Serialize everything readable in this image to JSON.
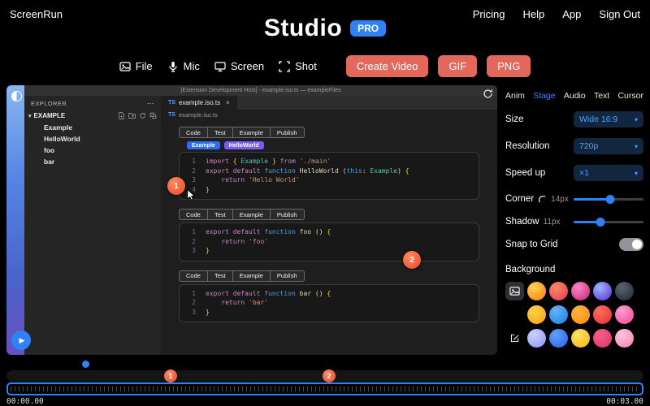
{
  "header": {
    "brand": "ScreenRun",
    "title": "Studio",
    "badge": "PRO",
    "links": [
      "Pricing",
      "Help",
      "App",
      "Sign Out"
    ]
  },
  "toolbar": {
    "sources": [
      {
        "icon": "file-image-icon",
        "label": "File"
      },
      {
        "icon": "mic-icon",
        "label": "Mic"
      },
      {
        "icon": "screen-icon",
        "label": "Screen"
      },
      {
        "icon": "shot-icon",
        "label": "Shot"
      }
    ],
    "actions": [
      {
        "label": "Create Video"
      },
      {
        "label": "GIF"
      },
      {
        "label": "PNG"
      }
    ]
  },
  "preview": {
    "window_title": "[Extension Development Host] - example.iso.ts — exampleFiles",
    "explorer": {
      "title": "EXPLORER",
      "more": "⋯",
      "section": "EXAMPLE",
      "files": [
        "Example",
        "HelloWorld",
        "foo",
        "bar"
      ]
    },
    "tab": {
      "lang": "TS",
      "name": "example.iso.ts",
      "close": "×"
    },
    "breadcrumb": {
      "lang": "TS",
      "name": "example.iso.ts"
    },
    "blocks": [
      {
        "tabs": [
          "Code",
          "Test",
          "Example",
          "Publish"
        ],
        "badges": [
          {
            "label": "Example",
            "color": "#2f6bf0"
          },
          {
            "label": "HelloWorld",
            "color": "#7a5cf0"
          }
        ],
        "lines": [
          {
            "num": "1",
            "tokens": [
              {
                "t": "import",
                "c": "kw"
              },
              {
                "t": " ",
                "c": "pl"
              },
              {
                "t": "{",
                "c": "br"
              },
              {
                "t": " ",
                "c": "pl"
              },
              {
                "t": "Example",
                "c": "ty"
              },
              {
                "t": " ",
                "c": "pl"
              },
              {
                "t": "}",
                "c": "br"
              },
              {
                "t": " ",
                "c": "pl"
              },
              {
                "t": "from",
                "c": "kw"
              },
              {
                "t": " ",
                "c": "pl"
              },
              {
                "t": "'./main'",
                "c": "st"
              }
            ]
          },
          {
            "num": "2",
            "tokens": [
              {
                "t": "export",
                "c": "kw"
              },
              {
                "t": " ",
                "c": "pl"
              },
              {
                "t": "default",
                "c": "kw"
              },
              {
                "t": " ",
                "c": "pl"
              },
              {
                "t": "function",
                "c": "fn2"
              },
              {
                "t": " ",
                "c": "pl"
              },
              {
                "t": "HelloWorld",
                "c": "fn"
              },
              {
                "t": " (",
                "c": "pl"
              },
              {
                "t": "this",
                "c": "th"
              },
              {
                "t": ": ",
                "c": "pl"
              },
              {
                "t": "Example",
                "c": "ty"
              },
              {
                "t": ") ",
                "c": "pl"
              },
              {
                "t": "{",
                "c": "br"
              }
            ]
          },
          {
            "num": "3",
            "tokens": [
              {
                "t": "    ",
                "c": "pl"
              },
              {
                "t": "return",
                "c": "kw"
              },
              {
                "t": " ",
                "c": "pl"
              },
              {
                "t": "'Hello World'",
                "c": "st"
              }
            ]
          },
          {
            "num": "4",
            "tokens": [
              {
                "t": "}",
                "c": "br"
              }
            ]
          }
        ]
      },
      {
        "tabs": [
          "Code",
          "Test",
          "Example",
          "Publish"
        ],
        "badges": [],
        "lines": [
          {
            "num": "1",
            "tokens": [
              {
                "t": "export",
                "c": "kw"
              },
              {
                "t": " ",
                "c": "pl"
              },
              {
                "t": "default",
                "c": "kw"
              },
              {
                "t": " ",
                "c": "pl"
              },
              {
                "t": "function",
                "c": "fn2"
              },
              {
                "t": " ",
                "c": "pl"
              },
              {
                "t": "foo",
                "c": "fn"
              },
              {
                "t": " () ",
                "c": "pl"
              },
              {
                "t": "{",
                "c": "br"
              }
            ]
          },
          {
            "num": "2",
            "tokens": [
              {
                "t": "    ",
                "c": "pl"
              },
              {
                "t": "return",
                "c": "kw"
              },
              {
                "t": " ",
                "c": "pl"
              },
              {
                "t": "'foo'",
                "c": "st"
              }
            ]
          },
          {
            "num": "3",
            "tokens": [
              {
                "t": "}",
                "c": "br"
              }
            ]
          }
        ]
      },
      {
        "tabs": [
          "Code",
          "Test",
          "Example",
          "Publish"
        ],
        "badges": [],
        "lines": [
          {
            "num": "1",
            "tokens": [
              {
                "t": "export",
                "c": "kw"
              },
              {
                "t": " ",
                "c": "pl"
              },
              {
                "t": "default",
                "c": "kw"
              },
              {
                "t": " ",
                "c": "pl"
              },
              {
                "t": "function",
                "c": "fn2"
              },
              {
                "t": " ",
                "c": "pl"
              },
              {
                "t": "bar",
                "c": "fn"
              },
              {
                "t": " () ",
                "c": "pl"
              },
              {
                "t": "{",
                "c": "br"
              }
            ]
          },
          {
            "num": "2",
            "tokens": [
              {
                "t": "    ",
                "c": "pl"
              },
              {
                "t": "return",
                "c": "kw"
              },
              {
                "t": " ",
                "c": "pl"
              },
              {
                "t": "'bar'",
                "c": "st"
              }
            ]
          },
          {
            "num": "3",
            "tokens": [
              {
                "t": "}",
                "c": "br"
              }
            ]
          }
        ]
      }
    ],
    "markers": [
      {
        "n": "1"
      },
      {
        "n": "2"
      }
    ]
  },
  "panel": {
    "tabs": [
      {
        "label": "Anim",
        "active": false
      },
      {
        "label": "Stage",
        "active": true
      },
      {
        "label": "Audio",
        "active": false
      },
      {
        "label": "Text",
        "active": false
      },
      {
        "label": "Cursor",
        "active": false
      }
    ],
    "size": {
      "label": "Size",
      "value": "Wide 16:9"
    },
    "resolution": {
      "label": "Resolution",
      "value": "720p"
    },
    "speed": {
      "label": "Speed up",
      "value": "×1"
    },
    "corner": {
      "label": "Corner",
      "value": "14px",
      "percent": 52
    },
    "shadow": {
      "label": "Shadow",
      "value": "11px",
      "percent": 38
    },
    "snap": {
      "label": "Snap to Grid",
      "on": false
    },
    "background": {
      "label": "Background",
      "rows": [
        {
          "swatches": [
            [
              "#ffd34d",
              "#ff7a1a"
            ],
            [
              "#ff8a5c",
              "#e2395f"
            ],
            [
              "#ff86c2",
              "#c02678"
            ],
            [
              "#9db4ff",
              "#5b2bd6"
            ],
            [
              "#5a6472",
              "#23262e"
            ]
          ]
        },
        {
          "swatches": [
            [
              "#ffd24a",
              "#f59f0a"
            ],
            [
              "#63b3ff",
              "#1e80d9"
            ],
            [
              "#ffb347",
              "#ff8c00"
            ],
            [
              "#ff6b5e",
              "#e03131"
            ],
            [
              "#ff9bd0",
              "#ec4899"
            ]
          ]
        },
        {
          "swatches": [
            [
              "#cdd2ff",
              "#8b93f8"
            ],
            [
              "#5ea0ff",
              "#2563eb"
            ],
            [
              "#ffe066",
              "#f5b60a"
            ],
            [
              "#ff5e8a",
              "#d6336c"
            ],
            [
              "#ffc2e0",
              "#f783ac"
            ]
          ]
        }
      ]
    }
  },
  "timeline": {
    "start": "00:00.00",
    "end": "00:03.00",
    "markers": [
      {
        "n": "1"
      },
      {
        "n": "2"
      }
    ]
  },
  "colors": {
    "accent": "#2f81f7",
    "action_red": "#e2685c",
    "marker_orange": "#e8472b"
  }
}
